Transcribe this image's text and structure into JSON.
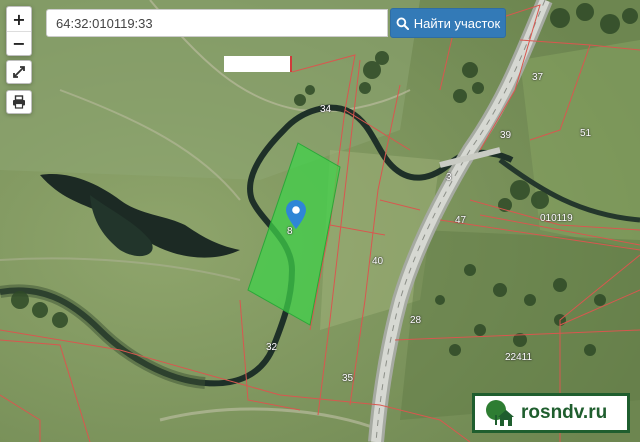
{
  "search": {
    "value": "64:32:010119:33",
    "button_label": "Найти участок"
  },
  "controls": {
    "zoom_in": "+",
    "zoom_out": "−"
  },
  "parcels": [
    "34",
    "37",
    "39",
    "51",
    "3",
    "47",
    "010119",
    "40",
    "8",
    "32",
    "35",
    "22411",
    "28"
  ],
  "brand": {
    "name": "rosndv.ru"
  },
  "colors": {
    "highlight": "#3fd34a",
    "boundary": "#d8574f",
    "search_button": "#337ab7",
    "brand": "#1f5e2e"
  }
}
